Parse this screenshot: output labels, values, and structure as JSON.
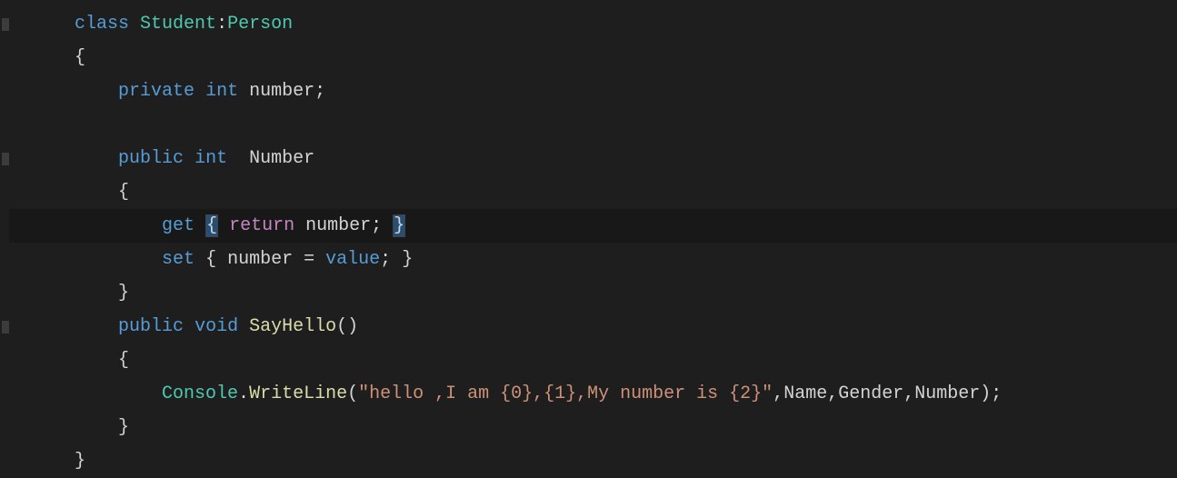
{
  "code": {
    "line1": {
      "indent": "      ",
      "class_kw": "class",
      "space1": " ",
      "class_name": "Student",
      "colon": ":",
      "base_class": "Person"
    },
    "line2": {
      "indent": "      ",
      "brace": "{"
    },
    "line3": {
      "indent": "          ",
      "access": "private",
      "space1": " ",
      "type": "int",
      "space2": " ",
      "name": "number",
      "semi": ";"
    },
    "line4": {
      "indent": ""
    },
    "line5": {
      "indent": "          ",
      "access": "public",
      "space1": " ",
      "type": "int",
      "space2": "  ",
      "name": "Number"
    },
    "line6": {
      "indent": "          ",
      "brace": "{"
    },
    "line7": {
      "indent": "              ",
      "get": "get",
      "space1": " ",
      "open": "{",
      "space2": " ",
      "return_kw": "return",
      "space3": " ",
      "field": "number",
      "semi": ";",
      "space4": " ",
      "close": "}"
    },
    "line8": {
      "indent": "              ",
      "set": "set",
      "space1": " ",
      "open": "{",
      "space2": " ",
      "field": "number",
      "space3": " ",
      "equals": "=",
      "space4": " ",
      "value": "value",
      "semi": ";",
      "space5": " ",
      "close": "}"
    },
    "line9": {
      "indent": "          ",
      "brace": "}"
    },
    "line10": {
      "indent": "          ",
      "access": "public",
      "space1": " ",
      "ret_type": "void",
      "space2": " ",
      "method": "SayHello",
      "parens": "()"
    },
    "line11": {
      "indent": "          ",
      "brace": "{"
    },
    "line12": {
      "indent": "              ",
      "console": "Console",
      "dot": ".",
      "writeline": "WriteLine",
      "open_paren": "(",
      "string": "\"hello ,I am {0},{1},My number is {2}\"",
      "comma1": ",",
      "arg1": "Name",
      "comma2": ",",
      "arg2": "Gender",
      "comma3": ",",
      "arg3": "Number",
      "close_paren": ")",
      "semi": ";"
    },
    "line13": {
      "indent": "          ",
      "brace": "}"
    },
    "line14": {
      "indent": "      ",
      "brace": "}"
    }
  }
}
